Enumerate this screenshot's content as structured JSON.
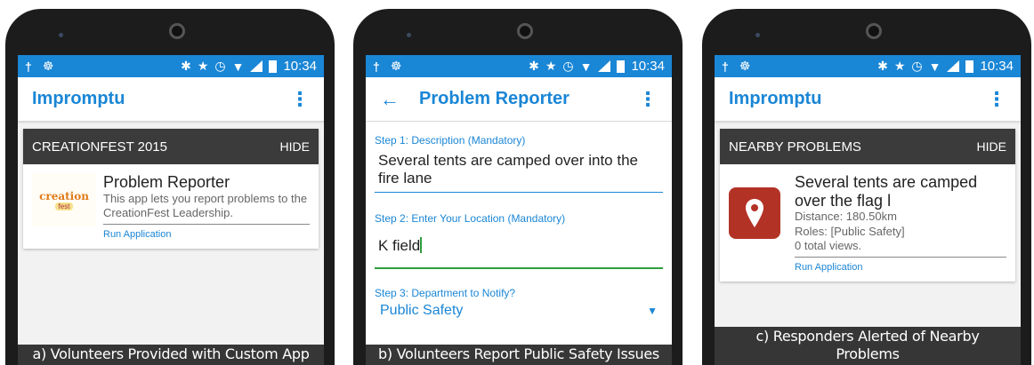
{
  "status_bar": {
    "time": "10:34",
    "left_icons": [
      "usb-icon",
      "android-icon"
    ],
    "right_icons": [
      "bluetooth-icon",
      "star-icon",
      "alarm-icon",
      "wifi-icon",
      "signal-icon",
      "battery-icon"
    ]
  },
  "panel_a": {
    "app_title": "Impromptu",
    "card_title": "CREATIONFEST 2015",
    "hide_label": "HIDE",
    "logo_text": "creation",
    "logo_sub": "fest",
    "item_title": "Problem Reporter",
    "item_desc": "This app lets you report problems to the CreationFest Leadership.",
    "run_link": "Run Application",
    "caption": "a) Volunteers Provided with Custom App"
  },
  "panel_b": {
    "app_title": "Problem Reporter",
    "step1_label": "Step 1: Description (Mandatory)",
    "step1_value": "Several tents are camped over into the fire lane",
    "step2_label": "Step 2: Enter Your Location (Mandatory)",
    "step2_value": "K field",
    "step3_label": "Step 3: Department to Notify?",
    "step3_value": "Public Safety",
    "caption": "b) Volunteers Report Public Safety Issues"
  },
  "panel_c": {
    "app_title": "Impromptu",
    "card_title": "NEARBY PROBLEMS",
    "hide_label": "HIDE",
    "item_title": "Several tents are camped over the flag l",
    "distance": "Distance: 180.50km",
    "roles": "Roles: [Public Safety]",
    "views": "0 total views.",
    "run_link": "Run Application",
    "caption": "c) Responders Alerted of Nearby Problems"
  },
  "colors": {
    "accent": "#1a86d6",
    "card_header": "#3b3b3b",
    "pin_bg": "#b33226",
    "active_field": "#2e9e3c"
  }
}
